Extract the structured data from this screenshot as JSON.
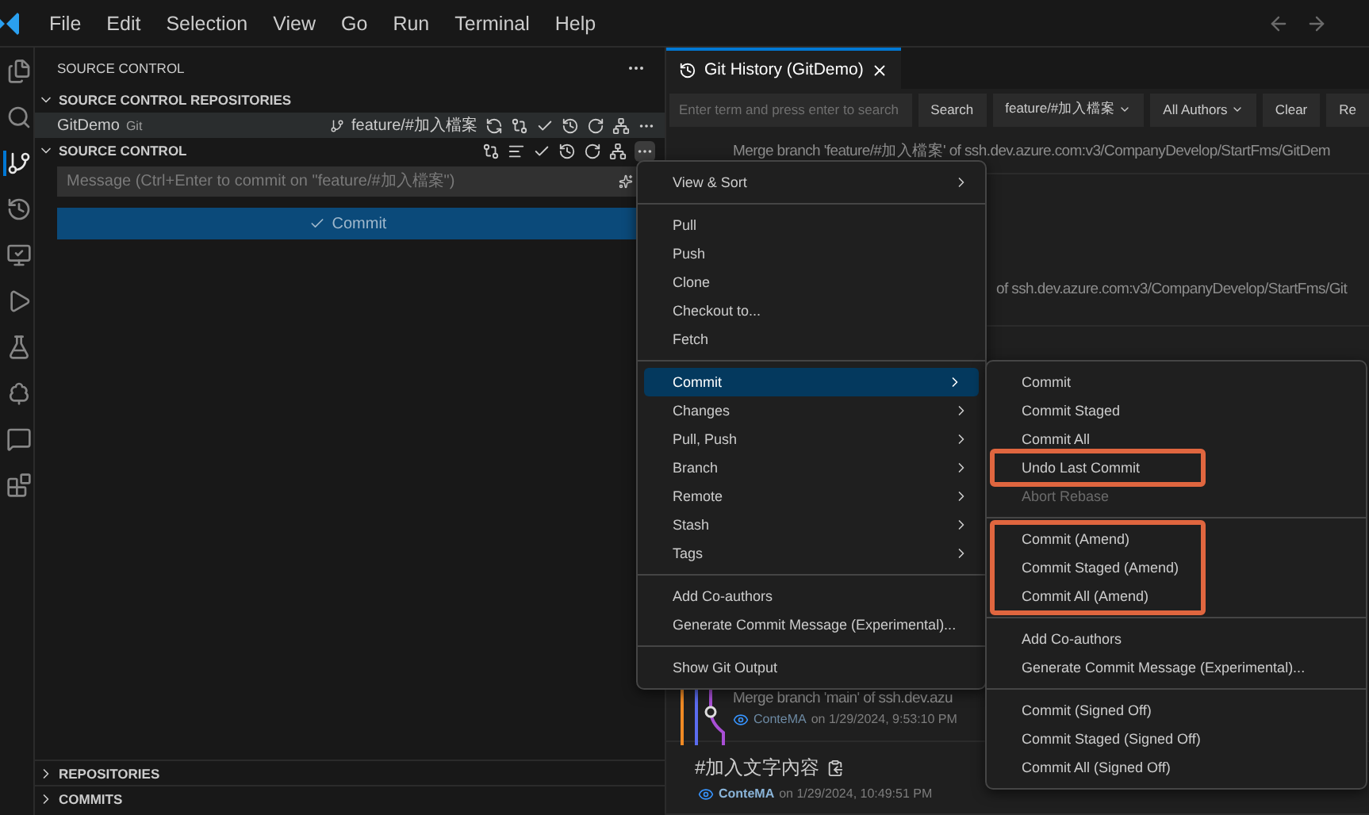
{
  "menubar": {
    "items": [
      "File",
      "Edit",
      "Selection",
      "View",
      "Go",
      "Run",
      "Terminal",
      "Help"
    ]
  },
  "activity_bar": {
    "items": [
      {
        "selected": false
      },
      {
        "selected": false
      },
      {
        "selected": true
      },
      {
        "selected": false
      },
      {
        "selected": false
      },
      {
        "selected": false
      },
      {
        "selected": false
      },
      {
        "selected": false
      },
      {
        "selected": false
      },
      {
        "selected": false
      }
    ]
  },
  "sidebar": {
    "title": "SOURCE CONTROL",
    "repositories_section": {
      "title": "SOURCE CONTROL REPOSITORIES",
      "expanded": true,
      "repo": {
        "name": "GitDemo",
        "provider": "Git",
        "branch": "feature/#加入檔案",
        "selected": true
      }
    },
    "source_control_section": {
      "title": "SOURCE CONTROL",
      "expanded": true,
      "message_placeholder": "Message (Ctrl+Enter to commit on \"feature/#加入檔案\")",
      "commit_button": "Commit"
    },
    "collapsed_sections": [
      {
        "title": "REPOSITORIES",
        "expanded": false
      },
      {
        "title": "COMMITS",
        "expanded": false
      }
    ]
  },
  "editor": {
    "tab": {
      "title": "Git History (GitDemo)",
      "selected": true
    },
    "toolbar": {
      "search_placeholder": "Enter term and press enter to search",
      "buttons": [
        {
          "label": "Search",
          "dropdown": false
        },
        {
          "label": "feature/#加入檔案",
          "dropdown": true
        },
        {
          "label": "All Authors",
          "dropdown": true
        },
        {
          "label": "Clear",
          "dropdown": false
        },
        {
          "label": "Re",
          "dropdown": false
        }
      ]
    },
    "commits": [
      {
        "title": "Merge branch 'feature/#加入檔案' of ssh.dev.azure.com:v3/CompanyDevelop/StartFms/GitDem",
        "covered": false,
        "graph": false
      },
      {
        "title": "of ssh.dev.azure.com:v3/CompanyDevelop/StartFms/Git",
        "covered": true,
        "graph": false
      },
      {
        "title": "Merge branch 'main' of ssh.dev.azu",
        "covered": false,
        "graph": true,
        "author": "ConteMA",
        "date": "on 1/29/2024, 9:53:10 PM"
      },
      {
        "title": "#加入文字內容",
        "covered": false,
        "graph": false,
        "author": "ConteMA",
        "date": "on 1/29/2024, 10:49:51 PM"
      }
    ]
  },
  "context_menu": {
    "groups": [
      [
        {
          "label": "View & Sort",
          "submenu": true,
          "selected": false
        }
      ],
      [
        {
          "label": "Pull",
          "submenu": false,
          "selected": false
        },
        {
          "label": "Push",
          "submenu": false,
          "selected": false
        },
        {
          "label": "Clone",
          "submenu": false,
          "selected": false
        },
        {
          "label": "Checkout to...",
          "submenu": false,
          "selected": false
        },
        {
          "label": "Fetch",
          "submenu": false,
          "selected": false
        }
      ],
      [
        {
          "label": "Commit",
          "submenu": true,
          "selected": true
        },
        {
          "label": "Changes",
          "submenu": true,
          "selected": false
        },
        {
          "label": "Pull, Push",
          "submenu": true,
          "selected": false
        },
        {
          "label": "Branch",
          "submenu": true,
          "selected": false
        },
        {
          "label": "Remote",
          "submenu": true,
          "selected": false
        },
        {
          "label": "Stash",
          "submenu": true,
          "selected": false
        },
        {
          "label": "Tags",
          "submenu": true,
          "selected": false
        }
      ],
      [
        {
          "label": "Add Co-authors",
          "submenu": false,
          "selected": false
        },
        {
          "label": "Generate Commit Message (Experimental)...",
          "submenu": false,
          "selected": false
        }
      ],
      [
        {
          "label": "Show Git Output",
          "submenu": false,
          "selected": false
        }
      ]
    ]
  },
  "commit_submenu": {
    "groups": [
      [
        {
          "label": "Commit",
          "disabled": false,
          "highlighted": false
        },
        {
          "label": "Commit Staged",
          "disabled": false,
          "highlighted": false
        },
        {
          "label": "Commit All",
          "disabled": false,
          "highlighted": false
        },
        {
          "label": "Undo Last Commit",
          "disabled": false,
          "highlighted": true
        },
        {
          "label": "Abort Rebase",
          "disabled": true,
          "highlighted": false
        }
      ],
      [
        {
          "label": "Commit (Amend)",
          "disabled": false,
          "highlighted": true
        },
        {
          "label": "Commit Staged (Amend)",
          "disabled": false,
          "highlighted": true
        },
        {
          "label": "Commit All (Amend)",
          "disabled": false,
          "highlighted": true
        }
      ],
      [
        {
          "label": "Add Co-authors",
          "disabled": false,
          "highlighted": false
        },
        {
          "label": "Generate Commit Message (Experimental)...",
          "disabled": false,
          "highlighted": false
        }
      ],
      [
        {
          "label": "Commit (Signed Off)",
          "disabled": false,
          "highlighted": false
        },
        {
          "label": "Commit Staged (Signed Off)",
          "disabled": false,
          "highlighted": false
        },
        {
          "label": "Commit All (Signed Off)",
          "disabled": false,
          "highlighted": false
        }
      ]
    ]
  }
}
